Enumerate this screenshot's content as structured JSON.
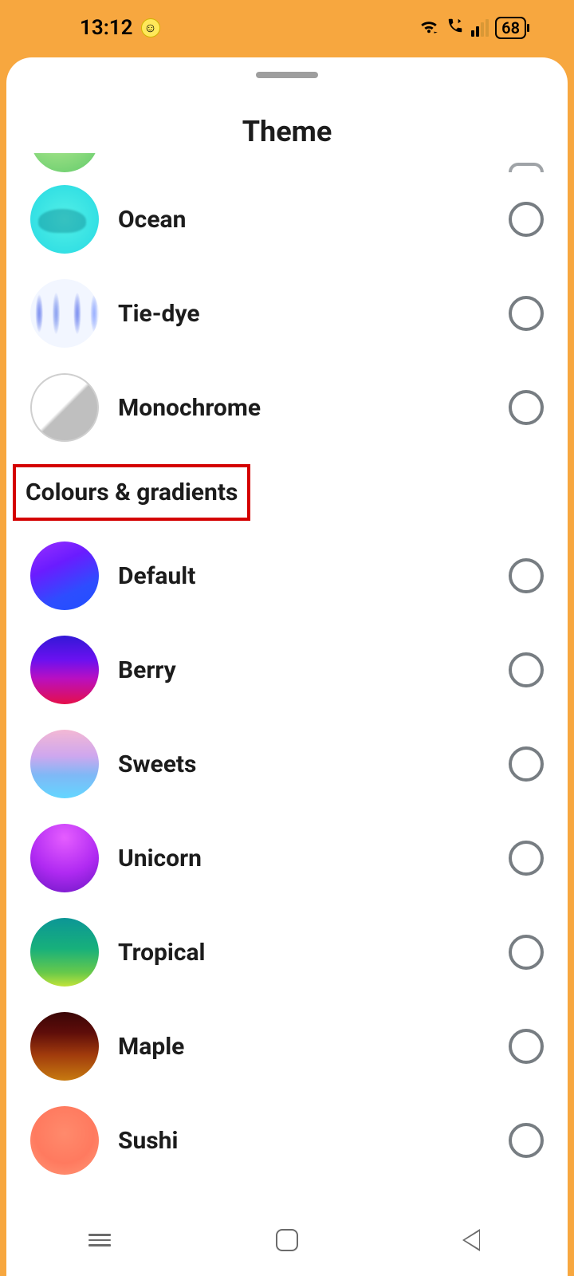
{
  "status": {
    "time": "13:12",
    "battery": "68"
  },
  "sheet": {
    "title": "Theme",
    "section_header": "Colours & gradients"
  },
  "themes": {
    "ocean": "Ocean",
    "tiedye": "Tie-dye",
    "monochrome": "Monochrome",
    "default": "Default",
    "berry": "Berry",
    "sweets": "Sweets",
    "unicorn": "Unicorn",
    "tropical": "Tropical",
    "maple": "Maple",
    "sushi": "Sushi"
  }
}
